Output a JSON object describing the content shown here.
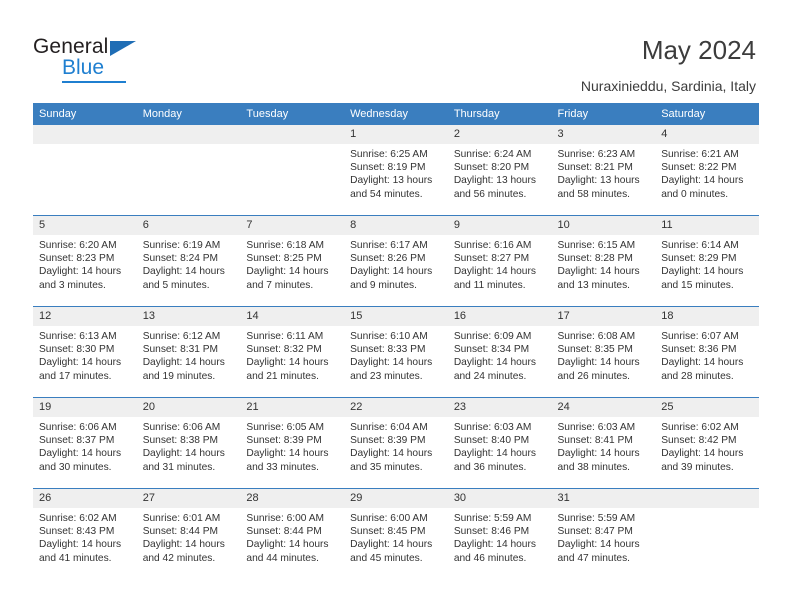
{
  "brand": {
    "name_top": "General",
    "name_bottom": "Blue",
    "accent_color": "#1f7fd0",
    "triangle_color": "#1f6db5"
  },
  "header": {
    "title": "May 2024",
    "subtitle": "Nuraxinieddu, Sardinia, Italy"
  },
  "calendar": {
    "header_bg": "#3a7ebf",
    "daynum_bg": "#efefef",
    "weekday_headers": [
      "Sunday",
      "Monday",
      "Tuesday",
      "Wednesday",
      "Thursday",
      "Friday",
      "Saturday"
    ],
    "weeks": [
      [
        {
          "day": "",
          "empty": true
        },
        {
          "day": "",
          "empty": true
        },
        {
          "day": "",
          "empty": true
        },
        {
          "day": "1",
          "sunrise": "Sunrise: 6:25 AM",
          "sunset": "Sunset: 8:19 PM",
          "daylight": "Daylight: 13 hours and 54 minutes."
        },
        {
          "day": "2",
          "sunrise": "Sunrise: 6:24 AM",
          "sunset": "Sunset: 8:20 PM",
          "daylight": "Daylight: 13 hours and 56 minutes."
        },
        {
          "day": "3",
          "sunrise": "Sunrise: 6:23 AM",
          "sunset": "Sunset: 8:21 PM",
          "daylight": "Daylight: 13 hours and 58 minutes."
        },
        {
          "day": "4",
          "sunrise": "Sunrise: 6:21 AM",
          "sunset": "Sunset: 8:22 PM",
          "daylight": "Daylight: 14 hours and 0 minutes."
        }
      ],
      [
        {
          "day": "5",
          "sunrise": "Sunrise: 6:20 AM",
          "sunset": "Sunset: 8:23 PM",
          "daylight": "Daylight: 14 hours and 3 minutes."
        },
        {
          "day": "6",
          "sunrise": "Sunrise: 6:19 AM",
          "sunset": "Sunset: 8:24 PM",
          "daylight": "Daylight: 14 hours and 5 minutes."
        },
        {
          "day": "7",
          "sunrise": "Sunrise: 6:18 AM",
          "sunset": "Sunset: 8:25 PM",
          "daylight": "Daylight: 14 hours and 7 minutes."
        },
        {
          "day": "8",
          "sunrise": "Sunrise: 6:17 AM",
          "sunset": "Sunset: 8:26 PM",
          "daylight": "Daylight: 14 hours and 9 minutes."
        },
        {
          "day": "9",
          "sunrise": "Sunrise: 6:16 AM",
          "sunset": "Sunset: 8:27 PM",
          "daylight": "Daylight: 14 hours and 11 minutes."
        },
        {
          "day": "10",
          "sunrise": "Sunrise: 6:15 AM",
          "sunset": "Sunset: 8:28 PM",
          "daylight": "Daylight: 14 hours and 13 minutes."
        },
        {
          "day": "11",
          "sunrise": "Sunrise: 6:14 AM",
          "sunset": "Sunset: 8:29 PM",
          "daylight": "Daylight: 14 hours and 15 minutes."
        }
      ],
      [
        {
          "day": "12",
          "sunrise": "Sunrise: 6:13 AM",
          "sunset": "Sunset: 8:30 PM",
          "daylight": "Daylight: 14 hours and 17 minutes."
        },
        {
          "day": "13",
          "sunrise": "Sunrise: 6:12 AM",
          "sunset": "Sunset: 8:31 PM",
          "daylight": "Daylight: 14 hours and 19 minutes."
        },
        {
          "day": "14",
          "sunrise": "Sunrise: 6:11 AM",
          "sunset": "Sunset: 8:32 PM",
          "daylight": "Daylight: 14 hours and 21 minutes."
        },
        {
          "day": "15",
          "sunrise": "Sunrise: 6:10 AM",
          "sunset": "Sunset: 8:33 PM",
          "daylight": "Daylight: 14 hours and 23 minutes."
        },
        {
          "day": "16",
          "sunrise": "Sunrise: 6:09 AM",
          "sunset": "Sunset: 8:34 PM",
          "daylight": "Daylight: 14 hours and 24 minutes."
        },
        {
          "day": "17",
          "sunrise": "Sunrise: 6:08 AM",
          "sunset": "Sunset: 8:35 PM",
          "daylight": "Daylight: 14 hours and 26 minutes."
        },
        {
          "day": "18",
          "sunrise": "Sunrise: 6:07 AM",
          "sunset": "Sunset: 8:36 PM",
          "daylight": "Daylight: 14 hours and 28 minutes."
        }
      ],
      [
        {
          "day": "19",
          "sunrise": "Sunrise: 6:06 AM",
          "sunset": "Sunset: 8:37 PM",
          "daylight": "Daylight: 14 hours and 30 minutes."
        },
        {
          "day": "20",
          "sunrise": "Sunrise: 6:06 AM",
          "sunset": "Sunset: 8:38 PM",
          "daylight": "Daylight: 14 hours and 31 minutes."
        },
        {
          "day": "21",
          "sunrise": "Sunrise: 6:05 AM",
          "sunset": "Sunset: 8:39 PM",
          "daylight": "Daylight: 14 hours and 33 minutes."
        },
        {
          "day": "22",
          "sunrise": "Sunrise: 6:04 AM",
          "sunset": "Sunset: 8:39 PM",
          "daylight": "Daylight: 14 hours and 35 minutes."
        },
        {
          "day": "23",
          "sunrise": "Sunrise: 6:03 AM",
          "sunset": "Sunset: 8:40 PM",
          "daylight": "Daylight: 14 hours and 36 minutes."
        },
        {
          "day": "24",
          "sunrise": "Sunrise: 6:03 AM",
          "sunset": "Sunset: 8:41 PM",
          "daylight": "Daylight: 14 hours and 38 minutes."
        },
        {
          "day": "25",
          "sunrise": "Sunrise: 6:02 AM",
          "sunset": "Sunset: 8:42 PM",
          "daylight": "Daylight: 14 hours and 39 minutes."
        }
      ],
      [
        {
          "day": "26",
          "sunrise": "Sunrise: 6:02 AM",
          "sunset": "Sunset: 8:43 PM",
          "daylight": "Daylight: 14 hours and 41 minutes."
        },
        {
          "day": "27",
          "sunrise": "Sunrise: 6:01 AM",
          "sunset": "Sunset: 8:44 PM",
          "daylight": "Daylight: 14 hours and 42 minutes."
        },
        {
          "day": "28",
          "sunrise": "Sunrise: 6:00 AM",
          "sunset": "Sunset: 8:44 PM",
          "daylight": "Daylight: 14 hours and 44 minutes."
        },
        {
          "day": "29",
          "sunrise": "Sunrise: 6:00 AM",
          "sunset": "Sunset: 8:45 PM",
          "daylight": "Daylight: 14 hours and 45 minutes."
        },
        {
          "day": "30",
          "sunrise": "Sunrise: 5:59 AM",
          "sunset": "Sunset: 8:46 PM",
          "daylight": "Daylight: 14 hours and 46 minutes."
        },
        {
          "day": "31",
          "sunrise": "Sunrise: 5:59 AM",
          "sunset": "Sunset: 8:47 PM",
          "daylight": "Daylight: 14 hours and 47 minutes."
        },
        {
          "day": "",
          "empty": true
        }
      ]
    ]
  }
}
